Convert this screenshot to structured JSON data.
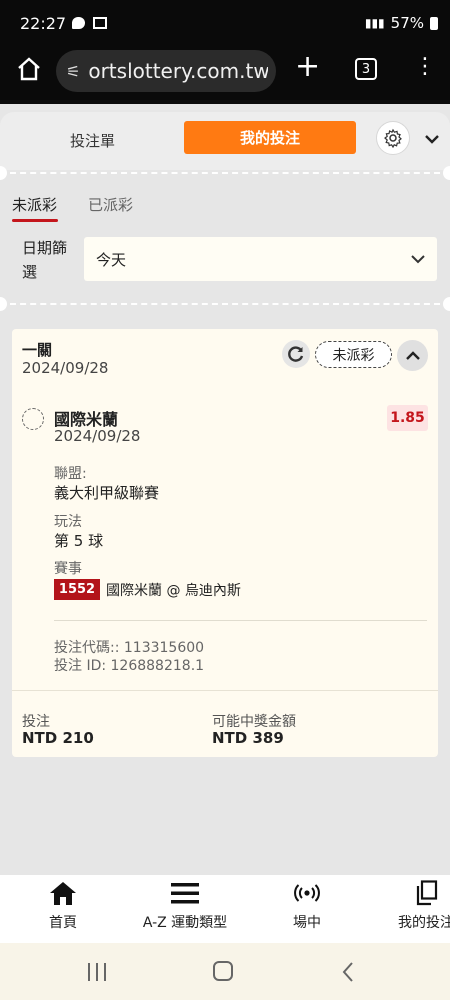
{
  "status_bar": {
    "time": "22:27",
    "battery": "57%"
  },
  "browser": {
    "url": "ortslottery.com.tw",
    "tab_count": "3"
  },
  "bet_header": {
    "betslip_tab": "投注單",
    "mybets_tab": "我的投注"
  },
  "sub_tabs": {
    "unsettled": "未派彩",
    "settled": "已派彩"
  },
  "date_filter": {
    "label": "日期篩選",
    "value": "今天"
  },
  "bet_card": {
    "type": "一關",
    "date": "2024/09/28",
    "status": "未派彩",
    "selection": {
      "team": "國際米蘭",
      "date": "2024/09/28",
      "odds": "1.85",
      "league_label": "聯盟:",
      "league": "義大利甲級聯賽",
      "market_label": "玩法",
      "market": "第 5 球",
      "event_label": "賽事",
      "event_id": "1552",
      "event_name": "國際米蘭 @ 烏迪內斯"
    },
    "bet_code": "投注代碼:: 113315600",
    "bet_id": "投注 ID: 126888218.1",
    "stake_label": "投注",
    "stake": "NTD 210",
    "payout_label": "可能中獎金額",
    "payout": "NTD 389"
  },
  "bottom_nav": [
    {
      "label": "首頁",
      "icon": "home-icon"
    },
    {
      "label": "A-Z 運動類型",
      "icon": "menu-icon"
    },
    {
      "label": "場中",
      "icon": "live-icon"
    },
    {
      "label": "我的投注",
      "icon": "copy-icon"
    }
  ],
  "colors": {
    "accent": "#ff7a12",
    "red": "#c4161c"
  }
}
